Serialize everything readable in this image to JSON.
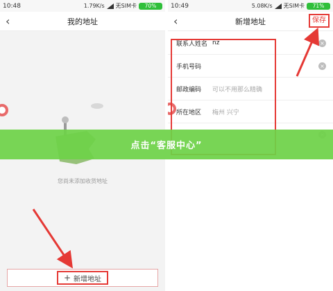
{
  "left_screen": {
    "status": {
      "time": "10:48",
      "speed": "1.79K/s",
      "carrier": "无SIM卡",
      "battery": "70%"
    },
    "nav": {
      "title": "我的地址"
    },
    "empty_text": "您尚未添加收货地址",
    "add_button": {
      "label": "新增地址"
    }
  },
  "right_screen": {
    "status": {
      "time": "10:49",
      "speed": "5.08K/s",
      "carrier": "无SIM卡",
      "battery": "71%"
    },
    "nav": {
      "title": "新增地址",
      "save_label": "保存"
    },
    "fields": [
      {
        "label": "联系人姓名",
        "value": "nz",
        "placeholder": ""
      },
      {
        "label": "手机号码",
        "value": "",
        "placeholder": ""
      },
      {
        "label": "邮政编码",
        "value": "",
        "placeholder": "可以不用那么精确"
      },
      {
        "label": "所在地区",
        "value": "",
        "placeholder": "梅州 兴宁"
      }
    ]
  },
  "banner": {
    "text": "点击“客服中心”"
  },
  "colors": {
    "annotation_red": "#e53935",
    "banner_green": "#6ed248",
    "battery_green": "#2fbf3a"
  }
}
